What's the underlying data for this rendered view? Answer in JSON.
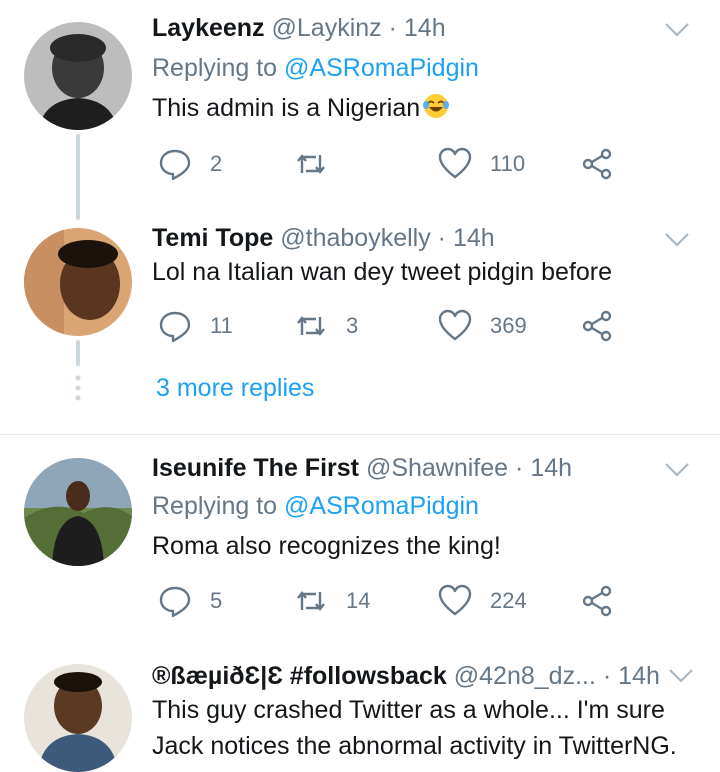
{
  "colors": {
    "accent": "#1da1f2",
    "muted": "#657786",
    "text": "#14171a",
    "divider": "#e1e8ed"
  },
  "tweets": [
    {
      "name": "Laykeenz",
      "handle": "@Laykinz",
      "dot": "·",
      "time": "14h",
      "reply_prefix": "Replying to",
      "reply_to": "@ASRomaPidgin",
      "text": "This admin is a Nigerian",
      "emoji": "face-with-tears-of-joy",
      "replies": "2",
      "retweets": "",
      "likes": "110"
    },
    {
      "name": "Temi Tope",
      "handle": "@thaboykelly",
      "dot": "·",
      "time": "14h",
      "text": "Lol na Italian wan dey tweet pidgin before",
      "replies": "11",
      "retweets": "3",
      "likes": "369"
    },
    {
      "name": "Iseunife The First",
      "handle": "@Shawnifee",
      "dot": "·",
      "time": "14h",
      "reply_prefix": "Replying to",
      "reply_to": "@ASRomaPidgin",
      "text": "Roma also recognizes the king!",
      "replies": "5",
      "retweets": "14",
      "likes": "224"
    },
    {
      "name": "®ßæµiðƐ|Ɛ #followsback",
      "handle": "@42n8_dz...",
      "dot": "·",
      "time": "14h",
      "text": "This guy crashed Twitter as a whole... I'm sure Jack notices the abnormal activity in TwitterNG."
    }
  ],
  "more_replies": "3 more replies"
}
